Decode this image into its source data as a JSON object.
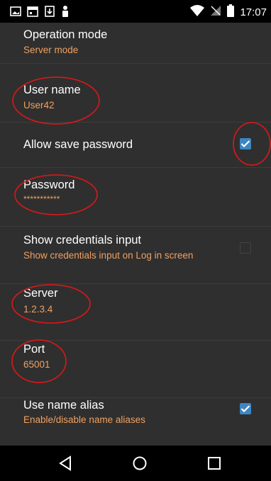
{
  "status_bar": {
    "time": "17:07",
    "left_icons": [
      "image-icon",
      "calendar-icon",
      "download-icon",
      "notification-person-icon"
    ],
    "right_icons": [
      "wifi-icon",
      "no-sim-icon",
      "battery-icon"
    ]
  },
  "prefs": {
    "operation_mode": {
      "title": "Operation mode",
      "summary": "Server mode"
    },
    "user_name": {
      "title": "User name",
      "summary": "User42"
    },
    "allow_save_password": {
      "title": "Allow save password",
      "checked": true
    },
    "password": {
      "title": "Password",
      "summary": "***********"
    },
    "show_credentials": {
      "title": "Show credentials input",
      "summary": "Show credentials input on Log in screen",
      "checked": false
    },
    "server": {
      "title": "Server",
      "summary": "1.2.3.4"
    },
    "port": {
      "title": "Port",
      "summary": "65001"
    },
    "use_name_alias": {
      "title": "Use name alias",
      "summary": "Enable/disable name aliases",
      "checked": true
    }
  },
  "nav_bar": {
    "buttons": [
      "back-icon",
      "home-icon",
      "recents-icon"
    ]
  },
  "colors": {
    "background": "#2f2f2f",
    "summary_text": "#f0a060",
    "checkbox_checked": "#3e86c2",
    "annotation_circle": "#cc1a1a",
    "bars": "#000000"
  }
}
